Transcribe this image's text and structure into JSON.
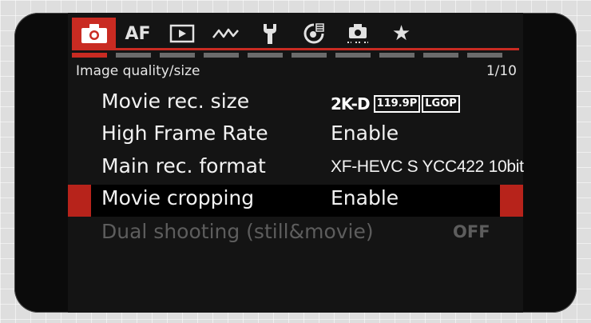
{
  "tabs": [
    {
      "name": "shooting",
      "icon": "camera-icon",
      "label": ""
    },
    {
      "name": "af",
      "icon": "",
      "label": "AF"
    },
    {
      "name": "playback",
      "icon": "playback-icon",
      "label": ""
    },
    {
      "name": "wireless",
      "icon": "wireless-icon",
      "label": ""
    },
    {
      "name": "setup",
      "icon": "wrench-icon",
      "label": ""
    },
    {
      "name": "custom-functions",
      "icon": "custom-functions-icon",
      "label": ""
    },
    {
      "name": "custom-mode",
      "icon": "custom-mode-icon",
      "label": ""
    },
    {
      "name": "my-menu",
      "icon": "star-icon",
      "label": "★"
    }
  ],
  "header": {
    "section_title": "Image quality/size",
    "page": "1/10"
  },
  "rows": [
    {
      "label": "Movie rec. size",
      "value_main": "2K-D",
      "value_fps": "119.9P",
      "value_codec": "LGOP"
    },
    {
      "label": "High Frame Rate",
      "value": "Enable"
    },
    {
      "label": "Main rec. format",
      "value": "XF-HEVC S YCC422 10bit"
    },
    {
      "label": "Movie cropping",
      "value": "Enable",
      "selected": true
    },
    {
      "label": "Dual shooting (still&movie)",
      "value": "OFF",
      "disabled": true
    }
  ],
  "colors": {
    "accent": "#c92b22",
    "background": "#141414",
    "text": "#f2f2f2",
    "disabled": "#5d5d5d"
  }
}
